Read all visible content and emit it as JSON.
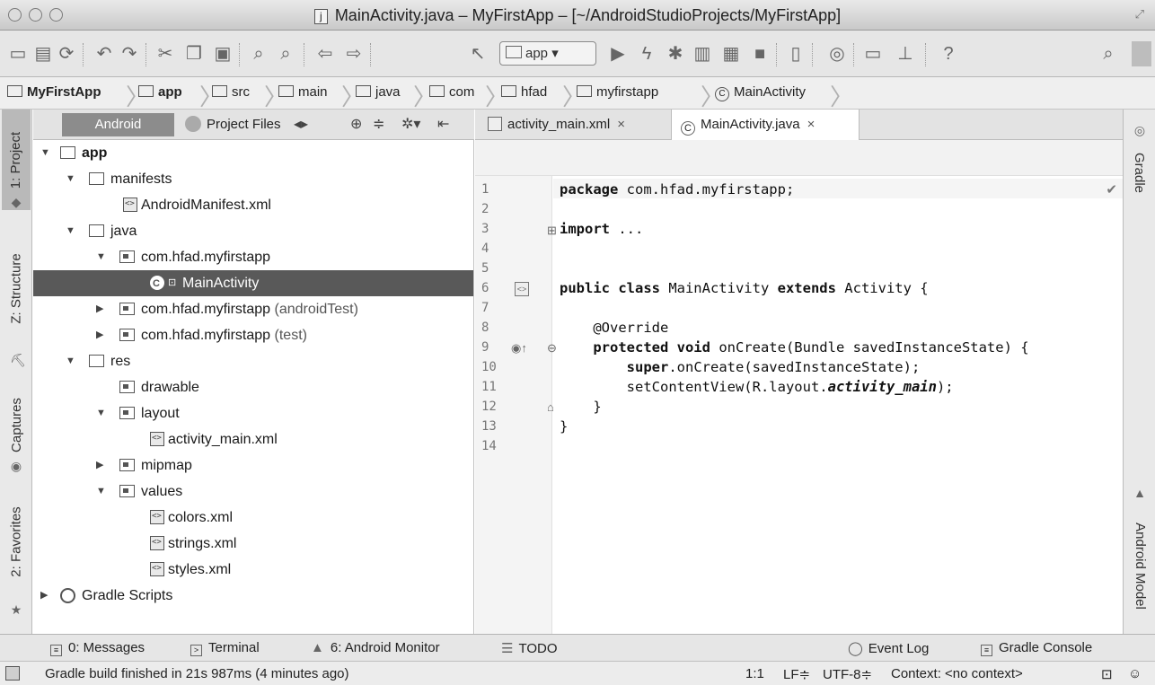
{
  "window": {
    "title": "MainActivity.java – MyFirstApp – [~/AndroidStudioProjects/MyFirstApp]"
  },
  "toolbar": {
    "run_config": "app",
    "icons": [
      "open-icon",
      "save-icon",
      "sync-icon",
      "undo-icon",
      "redo-icon",
      "cut-icon",
      "copy-icon",
      "paste-icon",
      "find-icon",
      "replace-icon",
      "back-icon",
      "forward-icon",
      "make-icon",
      "run-icon",
      "apply-changes-icon",
      "debug-icon",
      "profile-icon",
      "attach-debugger-icon",
      "stop-icon",
      "avd-manager-icon",
      "sdk-manager-icon",
      "device-monitor-icon",
      "project-structure-icon",
      "help-icon",
      "search-everywhere-icon"
    ]
  },
  "navbar": {
    "crumbs": [
      "MyFirstApp",
      "app",
      "src",
      "main",
      "java",
      "com",
      "hfad",
      "myfirstapp",
      "MainActivity"
    ]
  },
  "left_tabs": [
    "1: Project",
    "Z: Structure",
    "Captures",
    "2: Favorites"
  ],
  "right_tabs": [
    "Gradle",
    "Android Model"
  ],
  "project_panel": {
    "view_android": "Android",
    "view_project_files": "Project Files"
  },
  "tree": [
    {
      "label": "app",
      "suffix": ""
    },
    {
      "label": "manifests",
      "suffix": ""
    },
    {
      "label": "AndroidManifest.xml",
      "suffix": ""
    },
    {
      "label": "java",
      "suffix": ""
    },
    {
      "label": "com.hfad.myfirstapp",
      "suffix": ""
    },
    {
      "label": "MainActivity",
      "suffix": ""
    },
    {
      "label": "com.hfad.myfirstapp",
      "suffix": "(androidTest)"
    },
    {
      "label": "com.hfad.myfirstapp",
      "suffix": "(test)"
    },
    {
      "label": "res",
      "suffix": ""
    },
    {
      "label": "drawable",
      "suffix": ""
    },
    {
      "label": "layout",
      "suffix": ""
    },
    {
      "label": "activity_main.xml",
      "suffix": ""
    },
    {
      "label": "mipmap",
      "suffix": ""
    },
    {
      "label": "values",
      "suffix": ""
    },
    {
      "label": "colors.xml",
      "suffix": ""
    },
    {
      "label": "strings.xml",
      "suffix": ""
    },
    {
      "label": "styles.xml",
      "suffix": ""
    },
    {
      "label": "Gradle Scripts",
      "suffix": ""
    }
  ],
  "editor_tabs": [
    {
      "label": "activity_main.xml",
      "close": "×"
    },
    {
      "label": "MainActivity.java",
      "close": "×"
    }
  ],
  "code": {
    "line_numbers": [
      "1",
      "2",
      "3",
      "4",
      "5",
      "6",
      "7",
      "8",
      "9",
      "10",
      "11",
      "12",
      "13",
      "14"
    ],
    "l1_kw": "package",
    "l1_rest": " com.hfad.myfirstapp;",
    "l3_kw": "import",
    "l3_rest": " ...",
    "l6_kw1": "public class",
    "l6_mid": " MainActivity ",
    "l6_kw2": "extends",
    "l6_rest": " Activity {",
    "l8": "    @Override",
    "l9_kw": "    protected void",
    "l9_rest": " onCreate(Bundle savedInstanceState) {",
    "l10_kw": "        super",
    "l10_rest": ".onCreate(savedInstanceState);",
    "l11_pre": "        setContentView(R.layout.",
    "l11_it": "activity_main",
    "l11_post": ");",
    "l12": "    }",
    "l13": "}"
  },
  "bottom_tools": [
    {
      "label": "0: Messages"
    },
    {
      "label": "Terminal"
    },
    {
      "label": "6: Android Monitor"
    },
    {
      "label": "TODO"
    },
    {
      "label": "Event Log"
    },
    {
      "label": "Gradle Console"
    }
  ],
  "status": {
    "message": "Gradle build finished in 21s 987ms (4 minutes ago)",
    "position": "1:1",
    "line_sep": "LF≑",
    "encoding": "UTF-8≑",
    "context": "Context: <no context>"
  }
}
